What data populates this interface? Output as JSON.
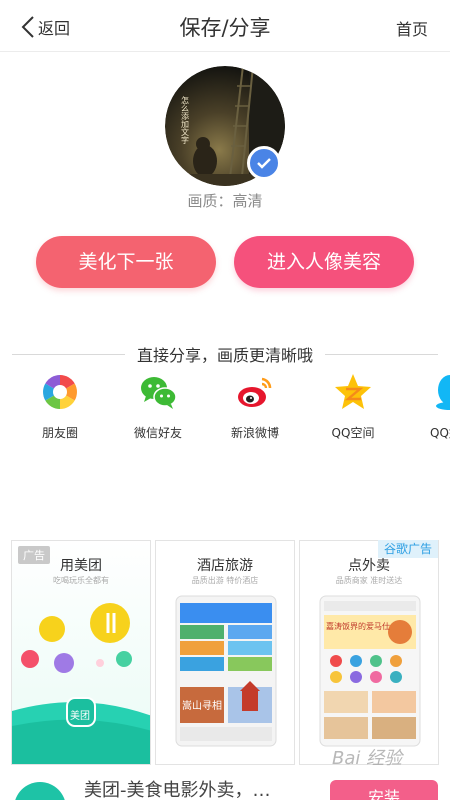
{
  "header": {
    "back_label": "返回",
    "title": "保存/分享",
    "home_label": "首页"
  },
  "preview": {
    "overlay_text": "怎么添加文字",
    "quality_text": "画质：高清"
  },
  "actions": {
    "beautify_next": "美化下一张",
    "portrait_beauty": "进入人像美容"
  },
  "share": {
    "title": "直接分享，画质更清晰哦",
    "items": [
      {
        "label": "朋友圈",
        "icon": "moments-icon"
      },
      {
        "label": "微信好友",
        "icon": "wechat-icon"
      },
      {
        "label": "新浪微博",
        "icon": "weibo-icon"
      },
      {
        "label": "QQ空间",
        "icon": "qzone-icon"
      },
      {
        "label": "QQ好友",
        "icon": "qq-icon"
      }
    ]
  },
  "ads": {
    "ad_label": "广告",
    "google_label": "谷歌广告",
    "cards": [
      {
        "title": "用美团",
        "subtitle": "吃喝玩乐全都有",
        "brand": "美团"
      },
      {
        "title": "酒店旅游",
        "subtitle": "品质出游 特价酒店",
        "banner": "嵩山寻相"
      },
      {
        "title": "点外卖",
        "subtitle": "品质商家 准时送达",
        "banner": "嘉涛饭界的爱马仕"
      }
    ],
    "bottom_text": "美团-美食电影外卖，…",
    "install_label": "安装"
  },
  "watermark": "Bai 经验",
  "colors": {
    "left_button": "#f46370",
    "right_button": "#f5517c",
    "check_badge": "#4a84e6"
  }
}
